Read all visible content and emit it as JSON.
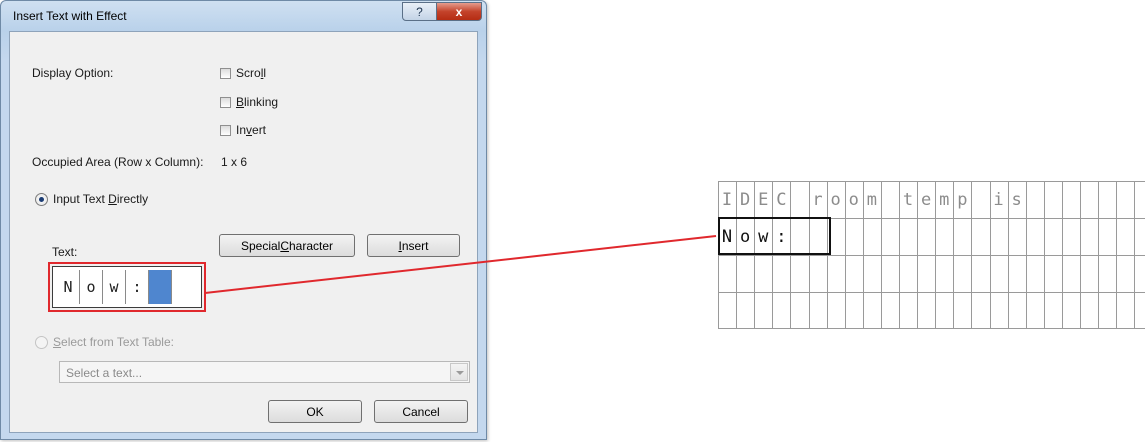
{
  "dialog": {
    "title": "Insert Text with Effect",
    "help_icon": "?",
    "close_icon": "x",
    "display_option_label": "Display Option:",
    "options": [
      {
        "pre": "Scro",
        "key": "l",
        "post": "l",
        "checked": false
      },
      {
        "pre": "",
        "key": "B",
        "post": "linking",
        "checked": false
      },
      {
        "pre": "In",
        "key": "v",
        "post": "ert",
        "checked": false
      }
    ],
    "occupied_area_label": "Occupied Area (Row x Column):",
    "occupied_area_value": "1 x 6",
    "input_directly": {
      "pre": "Input Text ",
      "key": "D",
      "post": "irectly",
      "selected": true
    },
    "text_label": "Text:",
    "special_character": {
      "pre": "Special ",
      "key": "C",
      "post": "haracter"
    },
    "insert": {
      "pre": "",
      "key": "I",
      "post": "nsert"
    },
    "text_cells": [
      "N",
      "o",
      "w",
      ":",
      "",
      ""
    ],
    "selected_cell_index": 4,
    "select_from_table": {
      "pre": "",
      "key": "S",
      "post": "elect from Text Table:",
      "selected": false,
      "enabled": false
    },
    "combo_placeholder": "Select a text...",
    "ok_label": "OK",
    "cancel_label": "Cancel"
  },
  "lcd": {
    "columns": 24,
    "rows": 4,
    "lines": [
      "IDEC room temp is",
      "Now:",
      "",
      ""
    ],
    "highlight": {
      "row": 1,
      "from_column": 0,
      "to_column": 5
    }
  },
  "colors": {
    "highlight_red": "#e0282d",
    "selected_cell_blue": "#4f86cf"
  }
}
